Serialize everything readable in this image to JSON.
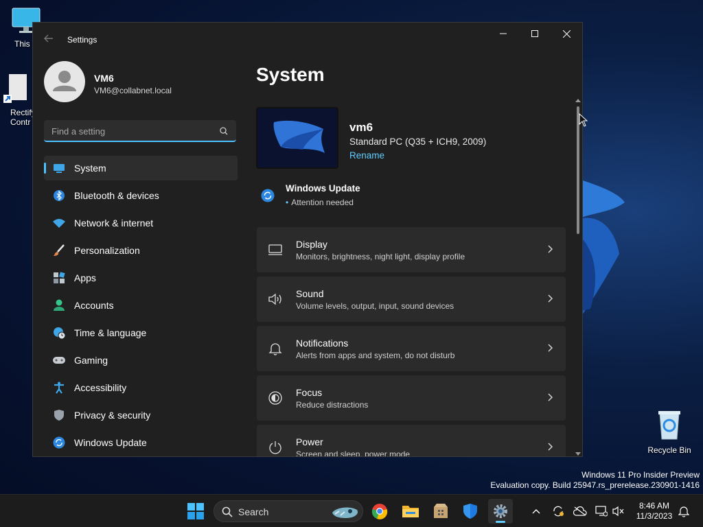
{
  "desktop": {
    "icons": [
      {
        "label": "This P"
      },
      {
        "label": "Rectify\nContr"
      },
      {
        "label": "Recycle Bin"
      }
    ],
    "watermark": {
      "line1": "Windows 11 Pro Insider Preview",
      "line2": "Evaluation copy. Build 25947.rs_prerelease.230901-1416"
    }
  },
  "window": {
    "title": "Settings",
    "user": {
      "name": "VM6",
      "email": "VM6@collabnet.local"
    },
    "search": {
      "placeholder": "Find a setting"
    },
    "nav": [
      {
        "label": "System",
        "icon": "system-icon",
        "active": true
      },
      {
        "label": "Bluetooth & devices",
        "icon": "bluetooth-icon"
      },
      {
        "label": "Network & internet",
        "icon": "wifi-icon"
      },
      {
        "label": "Personalization",
        "icon": "brush-icon"
      },
      {
        "label": "Apps",
        "icon": "apps-icon"
      },
      {
        "label": "Accounts",
        "icon": "accounts-icon"
      },
      {
        "label": "Time & language",
        "icon": "globe-clock-icon"
      },
      {
        "label": "Gaming",
        "icon": "gamepad-icon"
      },
      {
        "label": "Accessibility",
        "icon": "accessibility-icon"
      },
      {
        "label": "Privacy & security",
        "icon": "shield-icon"
      },
      {
        "label": "Windows Update",
        "icon": "update-icon"
      }
    ],
    "content": {
      "title": "System",
      "device": {
        "name": "vm6",
        "description": "Standard PC (Q35 + ICH9, 2009)",
        "rename": "Rename"
      },
      "update": {
        "title": "Windows Update",
        "status": "Attention needed"
      },
      "cards": [
        {
          "title": "Display",
          "subtitle": "Monitors, brightness, night light, display profile",
          "icon": "monitor-icon"
        },
        {
          "title": "Sound",
          "subtitle": "Volume levels, output, input, sound devices",
          "icon": "speaker-icon"
        },
        {
          "title": "Notifications",
          "subtitle": "Alerts from apps and system, do not disturb",
          "icon": "bell-icon"
        },
        {
          "title": "Focus",
          "subtitle": "Reduce distractions",
          "icon": "focus-icon"
        },
        {
          "title": "Power",
          "subtitle": "Screen and sleep, power mode",
          "icon": "power-icon"
        }
      ]
    }
  },
  "taskbar": {
    "search_label": "Search",
    "time": "8:46 AM",
    "date": "11/3/2023"
  },
  "colors": {
    "accent": "#4cc2ff",
    "link": "#60cdff",
    "window_bg": "#202020",
    "card_bg": "#2b2b2b"
  }
}
